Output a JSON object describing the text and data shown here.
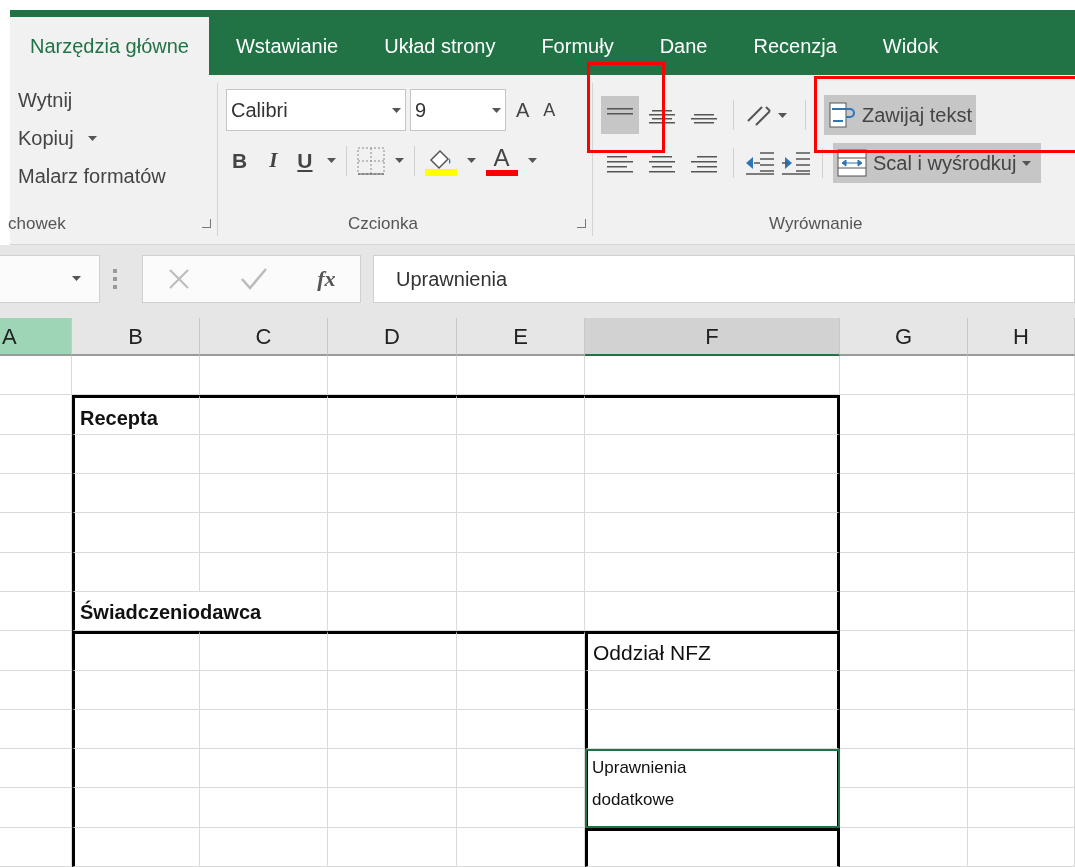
{
  "tabs": [
    {
      "label": "Narzędzia główne",
      "selected": true
    },
    {
      "label": "Wstawianie",
      "selected": false
    },
    {
      "label": "Układ strony",
      "selected": false
    },
    {
      "label": "Formuły",
      "selected": false
    },
    {
      "label": "Dane",
      "selected": false
    },
    {
      "label": "Recenzja",
      "selected": false
    },
    {
      "label": "Widok",
      "selected": false
    }
  ],
  "clipboard": {
    "items": [
      "Wytnij",
      "Kopiuj",
      "Malarz formatów"
    ],
    "label": "chowek"
  },
  "font": {
    "name": "Calibri",
    "size": "9",
    "grow": "A",
    "shrink": "A",
    "bold": "B",
    "italic": "I",
    "underline": "U",
    "font_color": "A",
    "label": "Czcionka"
  },
  "alignment": {
    "vertical": [
      {
        "kind": "top",
        "selected": true
      },
      {
        "kind": "middle",
        "selected": false
      },
      {
        "kind": "bottom",
        "selected": false
      }
    ],
    "horizontal": [
      {
        "kind": "left",
        "selected": false
      },
      {
        "kind": "center",
        "selected": false
      },
      {
        "kind": "right",
        "selected": false
      }
    ],
    "wrap": {
      "label": "Zawijaj tekst",
      "on": true
    },
    "merge": {
      "label": "Scal i wyśrodkuj",
      "on": true
    },
    "label": "Wyrównanie"
  },
  "formula_bar": {
    "value": "Uprawnienia",
    "fx": "fx"
  },
  "sheet": {
    "columns": [
      {
        "label": "A",
        "selected": false,
        "highlighted": true
      },
      {
        "label": "B",
        "selected": false,
        "highlighted": false
      },
      {
        "label": "C",
        "selected": false,
        "highlighted": false
      },
      {
        "label": "D",
        "selected": false,
        "highlighted": false
      },
      {
        "label": "E",
        "selected": false,
        "highlighted": false
      },
      {
        "label": "F",
        "selected": true,
        "highlighted": false
      },
      {
        "label": "G",
        "selected": false,
        "highlighted": false
      },
      {
        "label": "H",
        "selected": false,
        "highlighted": false
      }
    ],
    "cells": [
      {
        "text": "Recepta",
        "bold": true,
        "selected": false
      },
      {
        "text": "Świadczeniodawca",
        "bold": true,
        "selected": false
      },
      {
        "text": "Oddział NFZ",
        "bold": false,
        "selected": false
      },
      {
        "text": "Uprawnienia dodatkowe",
        "bold": false,
        "selected": true
      }
    ]
  }
}
